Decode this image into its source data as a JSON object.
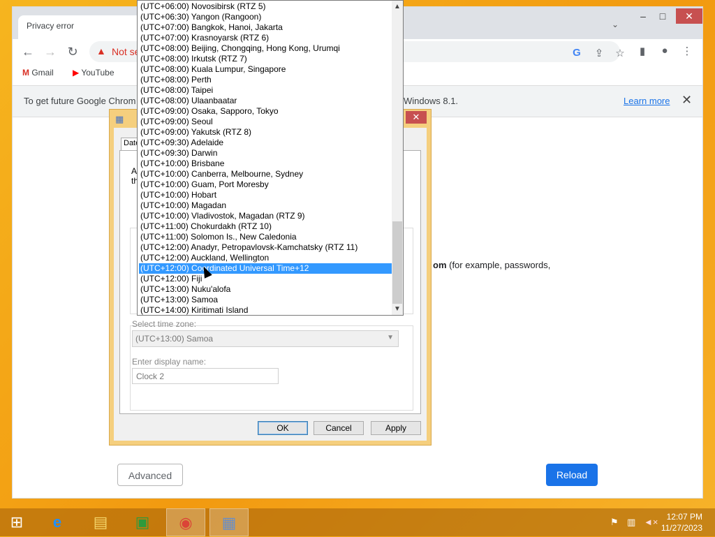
{
  "browser": {
    "tab_title": "Privacy error",
    "address_text": "Not se",
    "bookmarks": [
      {
        "label": "Gmail",
        "icon": "gmail-icon"
      },
      {
        "label": "YouTube",
        "icon": "youtube-icon"
      }
    ],
    "infobar": {
      "text_start": "To get future Google Chrom",
      "text_end": "Windows 8.1.",
      "learn_more": "Learn more"
    },
    "page": {
      "body_bold": "om",
      "body_rest": " (for example, passwords,",
      "advanced_label": "Advanced",
      "reload_label": "Reload"
    }
  },
  "dialog": {
    "tab_label": "Date",
    "text_a": "A",
    "text_th": "th",
    "select_label": "Select time zone:",
    "select_value": "(UTC+13:00) Samoa",
    "display_name_label": "Enter display name:",
    "display_name_value": "Clock 2",
    "ok_label": "OK",
    "cancel_label": "Cancel",
    "apply_label": "Apply"
  },
  "timezones": [
    "(UTC+06:00) Novosibirsk (RTZ 5)",
    "(UTC+06:30) Yangon (Rangoon)",
    "(UTC+07:00) Bangkok, Hanoi, Jakarta",
    "(UTC+07:00) Krasnoyarsk (RTZ 6)",
    "(UTC+08:00) Beijing, Chongqing, Hong Kong, Urumqi",
    "(UTC+08:00) Irkutsk (RTZ 7)",
    "(UTC+08:00) Kuala Lumpur, Singapore",
    "(UTC+08:00) Perth",
    "(UTC+08:00) Taipei",
    "(UTC+08:00) Ulaanbaatar",
    "(UTC+09:00) Osaka, Sapporo, Tokyo",
    "(UTC+09:00) Seoul",
    "(UTC+09:00) Yakutsk (RTZ 8)",
    "(UTC+09:30) Adelaide",
    "(UTC+09:30) Darwin",
    "(UTC+10:00) Brisbane",
    "(UTC+10:00) Canberra, Melbourne, Sydney",
    "(UTC+10:00) Guam, Port Moresby",
    "(UTC+10:00) Hobart",
    "(UTC+10:00) Magadan",
    "(UTC+10:00) Vladivostok, Magadan (RTZ 9)",
    "(UTC+11:00) Chokurdakh (RTZ 10)",
    "(UTC+11:00) Solomon Is., New Caledonia",
    "(UTC+12:00) Anadyr, Petropavlovsk-Kamchatsky (RTZ 11)",
    "(UTC+12:00) Auckland, Wellington",
    "(UTC+12:00) Coordinated Universal Time+12",
    "(UTC+12:00) Fiji",
    "(UTC+13:00) Nuku'alofa",
    "(UTC+13:00) Samoa",
    "(UTC+14:00) Kiritimati Island"
  ],
  "selected_timezone": "(UTC+12:00) Coordinated Universal Time+12",
  "taskbar": {
    "items": [
      "start-icon",
      "internet-explorer-icon",
      "file-explorer-icon",
      "store-icon",
      "chrome-icon",
      "date-time-icon"
    ],
    "clock_time": "12:07 PM",
    "clock_date": "11/27/2023"
  }
}
